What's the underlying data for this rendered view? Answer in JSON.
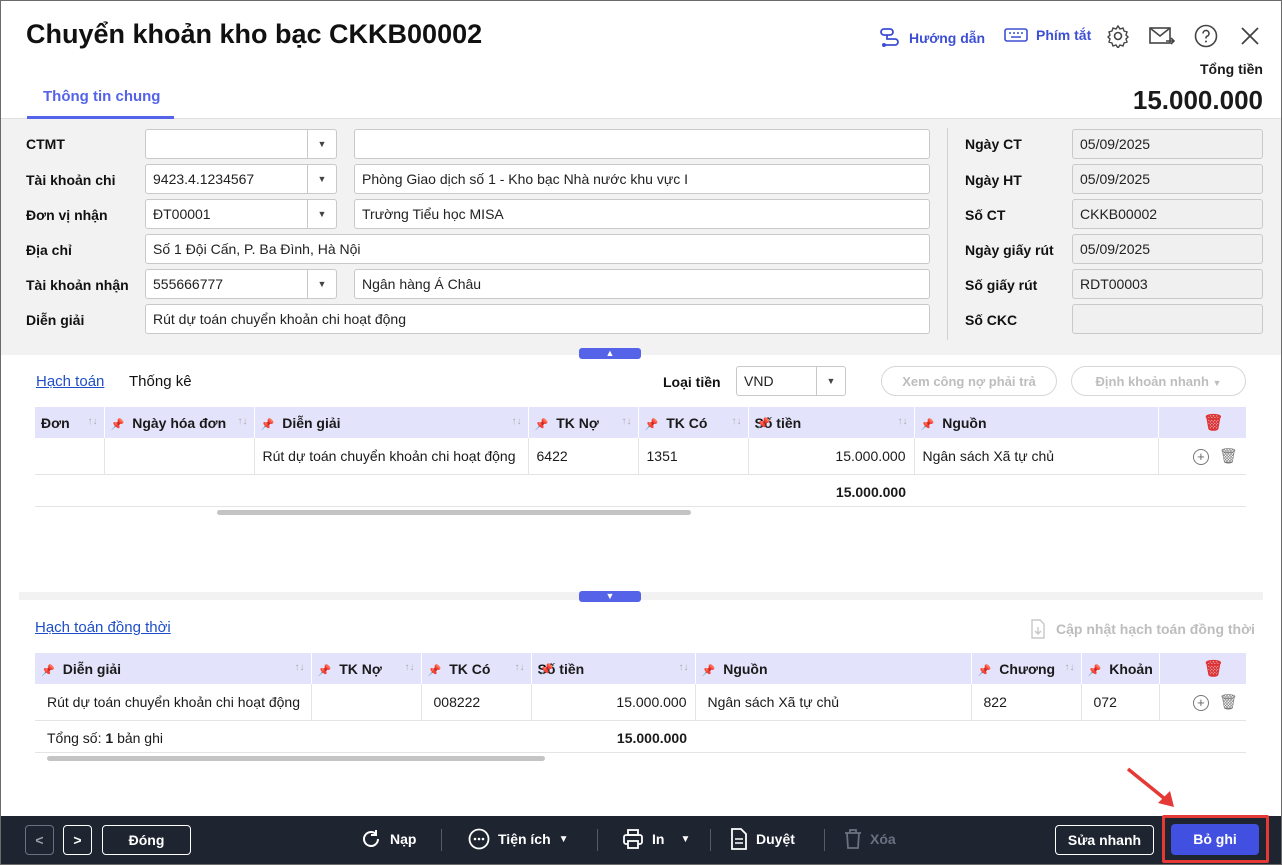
{
  "window": {
    "title": "Chuyển khoản kho bạc CKKB00002",
    "tab": "Thông tin chung",
    "help_label": "Hướng dẫn",
    "shortcut_label": "Phím tắt",
    "total_label": "Tổng tiền",
    "total_value": "15.000.000"
  },
  "form": {
    "ctmt_label": "CTMT",
    "ctmt_code": "",
    "ctmt_name": "",
    "account_label": "Tài khoản chi",
    "account_code": "9423.4.1234567",
    "account_name": "Phòng Giao dịch số 1 - Kho bạc Nhà nước khu vực I",
    "unit_label": "Đơn vị nhận",
    "unit_code": "ĐT00001",
    "unit_name": "Trường Tiểu học MISA",
    "address_label": "Địa chỉ",
    "address_value": "Số 1 Đội Cấn, P. Ba Đình, Hà Nội",
    "recv_account_label": "Tài khoản nhận",
    "recv_account_code": "555666777",
    "recv_account_name": "Ngân hàng Á Châu",
    "desc_label": "Diễn giải",
    "desc_value": "Rút dự toán chuyển khoản chi hoạt động",
    "date_ct_label": "Ngày CT",
    "date_ct": "05/09/2025",
    "date_ht_label": "Ngày HT",
    "date_ht": "05/09/2025",
    "no_ct_label": "Số CT",
    "no_ct": "CKKB00002",
    "date_gr_label": "Ngày giấy rút",
    "date_gr": "05/09/2025",
    "no_gr_label": "Số giấy rút",
    "no_gr": "RDT00003",
    "no_ckc_label": "Số CKC",
    "no_ckc": ""
  },
  "accounting": {
    "tab_active": "Hạch toán",
    "tab_other": "Thống kê",
    "currency_label": "Loại tiền",
    "currency": "VND",
    "btn_debt": "Xem công nợ phải trả",
    "btn_quick": "Định khoản nhanh",
    "columns": [
      "Đơn",
      "Ngày hóa đơn",
      "Diễn giải",
      "TK Nợ",
      "TK Có",
      "Số tiền",
      "Nguồn"
    ],
    "row": {
      "invoice": "",
      "invoice_date": "",
      "desc": "Rút dự toán chuyển khoản chi hoạt động",
      "debit": "6422",
      "credit": "1351",
      "amount": "15.000.000",
      "source": "Ngân sách Xã tự chủ"
    },
    "total": "15.000.000"
  },
  "concurrent": {
    "title": "Hạch toán đồng thời",
    "update_label": "Cập nhật hạch toán đồng thời",
    "columns": [
      "Diễn giải",
      "TK Nợ",
      "TK Có",
      "Số tiền",
      "Nguồn",
      "Chương",
      "Khoản"
    ],
    "row": {
      "desc": "Rút dự toán chuyển khoản chi hoạt động",
      "debit": "",
      "credit": "008222",
      "amount": "15.000.000",
      "source": "Ngân sách Xã tự chủ",
      "chapter": "822",
      "item": "072"
    },
    "count_prefix": "Tổng số:",
    "count": "1",
    "count_suffix": "bản ghi",
    "total": "15.000.000"
  },
  "footer": {
    "prev": "<",
    "next": ">",
    "close": "Đóng",
    "reload": "Nạp",
    "utility": "Tiện ích",
    "print": "In",
    "approve": "Duyệt",
    "delete": "Xóa",
    "quick_edit": "Sửa nhanh",
    "unpost": "Bỏ ghi"
  },
  "colors": {
    "accent": "#5563e8",
    "primary_button": "#4150e0",
    "footer": "#1e2430",
    "highlight": "#e53935"
  }
}
